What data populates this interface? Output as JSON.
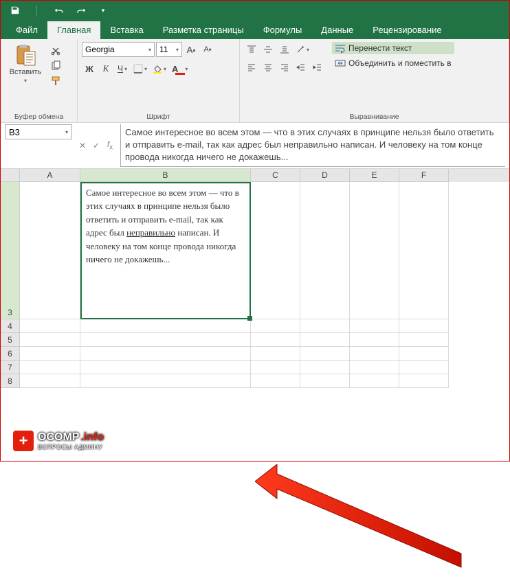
{
  "qat": {
    "save": "save-icon",
    "undo": "undo-icon",
    "redo": "redo-icon"
  },
  "tabs": {
    "file": "Файл",
    "home": "Главная",
    "insert": "Вставка",
    "layout": "Разметка страницы",
    "formulas": "Формулы",
    "data": "Данные",
    "review": "Рецензирование"
  },
  "clipboard": {
    "group_label": "Буфер обмена",
    "paste": "Вставить"
  },
  "font_group": {
    "group_label": "Шрифт",
    "font_name": "Georgia",
    "font_size": "11",
    "bold": "Ж",
    "italic": "К",
    "underline": "Ч"
  },
  "alignment": {
    "group_label": "Выравнивание",
    "wrap_text": "Перенести текст",
    "merge": "Объединить и поместить в"
  },
  "namebox": {
    "value": "B3"
  },
  "formula_bar": {
    "text": "Самое интересное во всем этом — что в этих случаях в принципе нельзя было ответить и отправить e-mail, так как адрес был неправильно написан. И человеку на том конце провода никогда ничего не докажешь..."
  },
  "columns": [
    "A",
    "B",
    "C",
    "D",
    "E",
    "F"
  ],
  "rows": {
    "r3": "3",
    "r4": "4",
    "r5": "5",
    "r6": "6",
    "r7": "7",
    "r8": "8"
  },
  "cell_b3": {
    "line1": "Самое интересное во всем этом — что в этих случаях в принципе нельзя было ответить и отправить e-mail, так как адрес был ",
    "underlined": "неправильно",
    "line2": " написан. И человеку на том конце провода никогда ничего не докажешь..."
  },
  "watermark": {
    "title_pre": "OCOMP",
    "title_suf": ".info",
    "sub": "ВОПРОСЫ АДМИНУ"
  }
}
